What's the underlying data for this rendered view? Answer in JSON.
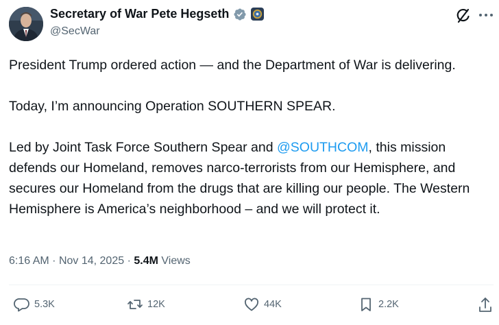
{
  "author": {
    "display_name": "Secretary of War Pete Hegseth",
    "handle": "@SecWar",
    "verified_icon": "verified-badge-icon",
    "affiliation_icon": "department-of-war-seal-icon"
  },
  "post": {
    "paragraphs": {
      "p1": "President Trump ordered action — and the Department of War is delivering.",
      "p2": "Today, I’m announcing Operation SOUTHERN SPEAR.",
      "p3_before": "Led by Joint Task Force Southern Spear and ",
      "p3_mention": "@SOUTHCOM",
      "p3_after": ", this mission defends our Homeland, removes narco-terrorists from our Hemisphere, and secures our Homeland from the drugs that are killing our people. The Western Hemisphere is America’s neighborhood – and we will protect it."
    },
    "time": "6:16 AM",
    "separator": "·",
    "date": "Nov 14, 2025",
    "views_count": "5.4M",
    "views_label": "Views"
  },
  "actions": {
    "replies": "5.3K",
    "reposts": "12K",
    "likes": "44K",
    "bookmarks": "2.2K"
  },
  "colors": {
    "text": "#0f1419",
    "secondary": "#536471",
    "link": "#1d9bf0",
    "verified": "#829aab"
  }
}
